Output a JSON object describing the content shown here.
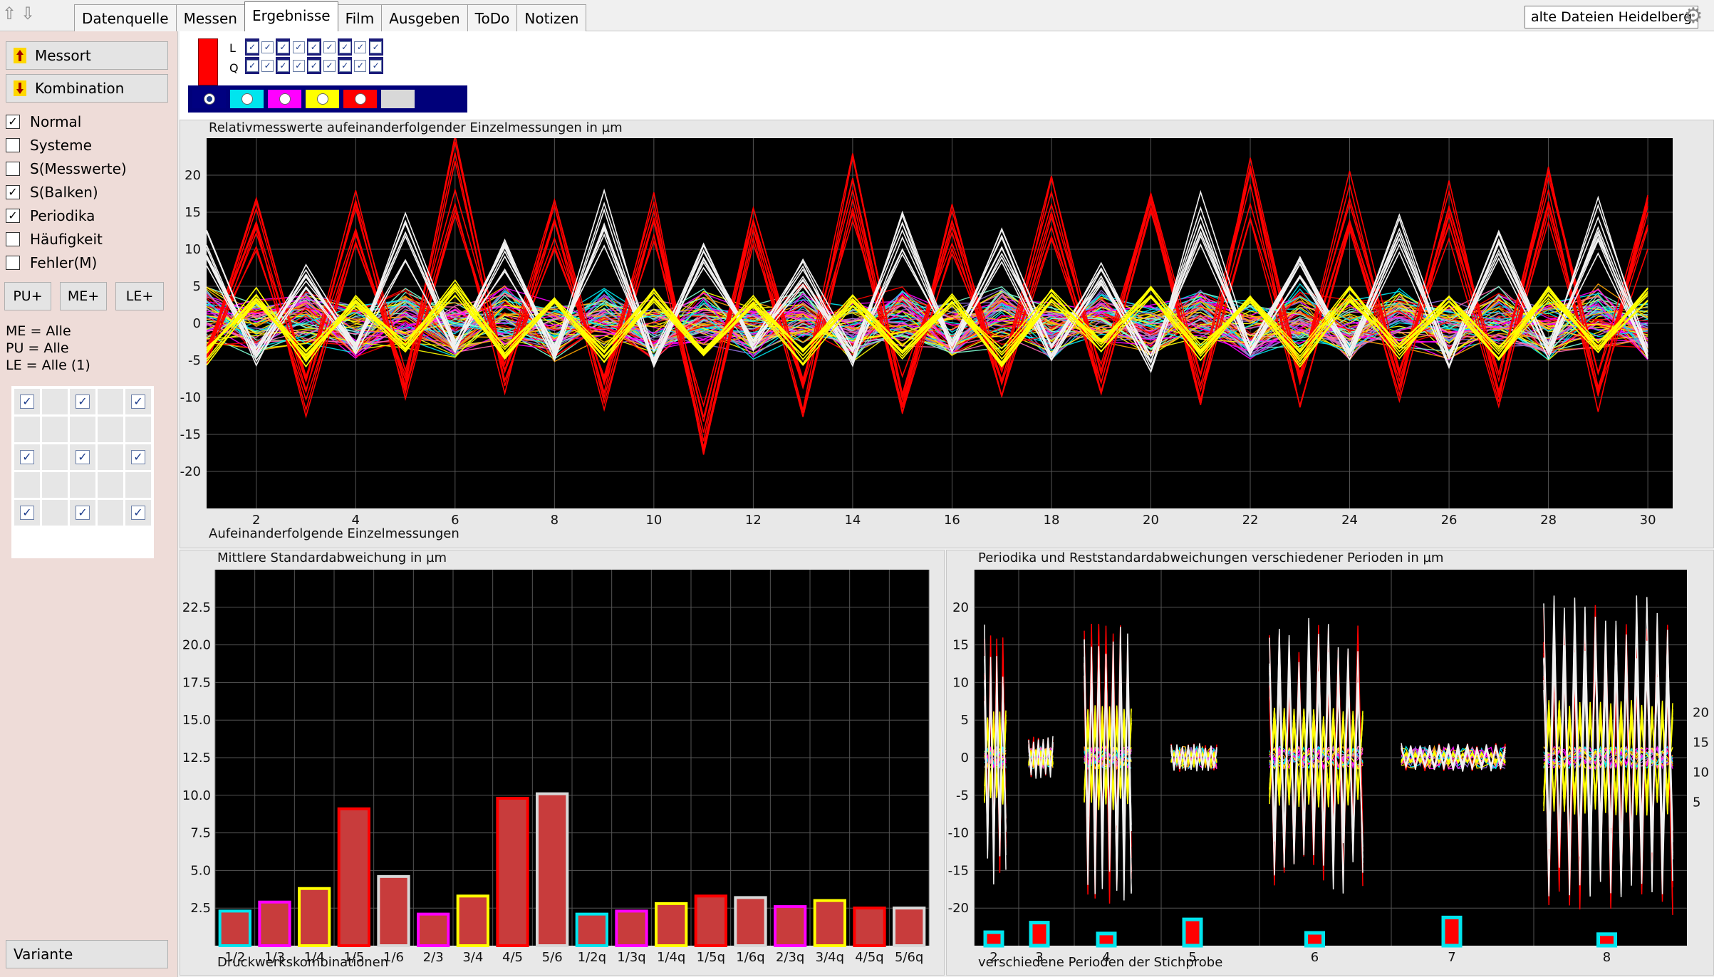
{
  "tabs": [
    "Datenquelle",
    "Messen",
    "Ergebnisse",
    "Film",
    "Ausgeben",
    "ToDo",
    "Notizen"
  ],
  "active_tab": "Ergebnisse",
  "dataset_label": "alte Dateien Heidelberg",
  "left_panel": {
    "messort_button": "Messort",
    "kombination_button": "Kombination",
    "checkboxes": [
      {
        "label": "Normal",
        "checked": true
      },
      {
        "label": "Systeme",
        "checked": false
      },
      {
        "label": "S(Messwerte)",
        "checked": false
      },
      {
        "label": "S(Balken)",
        "checked": true
      },
      {
        "label": "Periodika",
        "checked": true
      },
      {
        "label": "Häufigkeit",
        "checked": false
      },
      {
        "label": "Fehler(M)",
        "checked": false
      }
    ],
    "pu_button": "PU+",
    "me_button": "ME+",
    "le_button": "LE+",
    "info": [
      "ME = Alle",
      "PU = Alle",
      "LE = Alle (1)"
    ],
    "variant_button": "Variante"
  },
  "legend": {
    "row_labels": [
      "L",
      "Q"
    ],
    "swatch_colors": [
      "#000080",
      "#00e5ee",
      "#ff00ff",
      "#ffff00",
      "#ff0000",
      "#d8d8d8"
    ],
    "selected_swatch": 0
  },
  "top_chart": {
    "title": "Relativmesswerte aufeinanderfolgender Einzelmessungen in µm",
    "xlabel": "Aufeinanderfolgende Einzelmessungen",
    "x_ticks": [
      "2",
      "4",
      "6",
      "8",
      "10",
      "12",
      "14",
      "16",
      "18",
      "20",
      "22",
      "24",
      "26",
      "28",
      "30"
    ],
    "y_ticks": [
      "20",
      "15",
      "10",
      "5",
      "0",
      "-5",
      "-10",
      "-15",
      "-20"
    ]
  },
  "bar_chart": {
    "title": "Mittlere Standardabweichung in µm",
    "xlabel": "Druckwerkskombinationen",
    "y_ticks": [
      "22.5",
      "20.0",
      "17.5",
      "15.0",
      "12.5",
      "10.0",
      "7.5",
      "5.0",
      "2.5"
    ]
  },
  "period_chart": {
    "title": "Periodika und Reststandardabweichungen verschiedener Perioden in µm",
    "xlabel": "verschiedene Perioden der Stichprobe",
    "x_ticks": [
      "2",
      "3",
      "4",
      "5",
      "6",
      "7",
      "8"
    ],
    "y_ticks": [
      "20",
      "15",
      "10",
      "5",
      "0",
      "-5",
      "-10",
      "-15",
      "-20"
    ],
    "right_ticks": [
      "20",
      "15",
      "10",
      "5"
    ]
  },
  "chart_data": [
    {
      "type": "line",
      "title": "Relativmesswerte aufeinanderfolgender Einzelmessungen in µm",
      "xlabel": "Aufeinanderfolgende Einzelmessungen",
      "xlim": [
        1,
        30.5
      ],
      "ylim": [
        -25,
        25
      ],
      "grid": true,
      "series": [
        {
          "color": "#ff0000",
          "amplitude": [
            6,
            17,
            13,
            18,
            11,
            26,
            10,
            17,
            12,
            20,
            18,
            16,
            13,
            24,
            13,
            17,
            11,
            20,
            10,
            19,
            12,
            24,
            12,
            22,
            11,
            20,
            12,
            22,
            12,
            18
          ]
        },
        {
          "color": "#f0f0f0",
          "amplitude": [
            14,
            6,
            8,
            5,
            15,
            4,
            12,
            5,
            19,
            6,
            13,
            4,
            9,
            6,
            16,
            4,
            13,
            5,
            9,
            7,
            18,
            5,
            10,
            5,
            15,
            6,
            13,
            5,
            17,
            5
          ]
        },
        {
          "color": "#ffff00",
          "amplitude": [
            6,
            5,
            6,
            4,
            4,
            6,
            5,
            4,
            6,
            5,
            5,
            4,
            6,
            4,
            5,
            4,
            6,
            5,
            4,
            5,
            5,
            4,
            6,
            5,
            5,
            4,
            5,
            5,
            4,
            5
          ]
        }
      ]
    },
    {
      "type": "bar",
      "title": "Mittlere Standardabweichung in µm",
      "xlabel": "Druckwerkskombinationen",
      "categories": [
        "1/2",
        "1/3",
        "1/4",
        "1/5",
        "1/6",
        "2/3",
        "3/4",
        "4/5",
        "5/6",
        "1/2q",
        "1/3q",
        "1/4q",
        "1/5q",
        "1/6q",
        "2/3q",
        "3/4q",
        "4/5q",
        "5/6q"
      ],
      "values": [
        2.3,
        2.9,
        3.8,
        9.1,
        4.6,
        2.1,
        3.3,
        9.8,
        10.1,
        2.1,
        2.3,
        2.8,
        3.3,
        3.2,
        2.6,
        3.0,
        2.5,
        2.5
      ],
      "outline_colors": [
        "#00e5ee",
        "#ff00ff",
        "#ffff00",
        "#ff0000",
        "#d8d8d8",
        "#ff00ff",
        "#ffff00",
        "#ff0000",
        "#d8d8d8",
        "#00e5ee",
        "#ff00ff",
        "#ffff00",
        "#ff0000",
        "#d8d8d8",
        "#ff00ff",
        "#ffff00",
        "#ff0000",
        "#d8d8d8"
      ],
      "ylim": [
        0,
        25
      ],
      "grid": true
    },
    {
      "type": "line",
      "title": "Periodika und Reststandardabweichungen verschiedener Perioden in µm",
      "xlabel": "verschiedene Perioden der Stichprobe",
      "categories": [
        "2",
        "3",
        "4",
        "5",
        "6",
        "7",
        "8"
      ],
      "periodic_amplitude": [
        18,
        3,
        20,
        2,
        19,
        2,
        22
      ],
      "residual_std": [
        2.1,
        3.6,
        1.9,
        4.1,
        2.0,
        4.4,
        1.8
      ],
      "ylim": [
        -25,
        25
      ],
      "grid": true
    }
  ]
}
